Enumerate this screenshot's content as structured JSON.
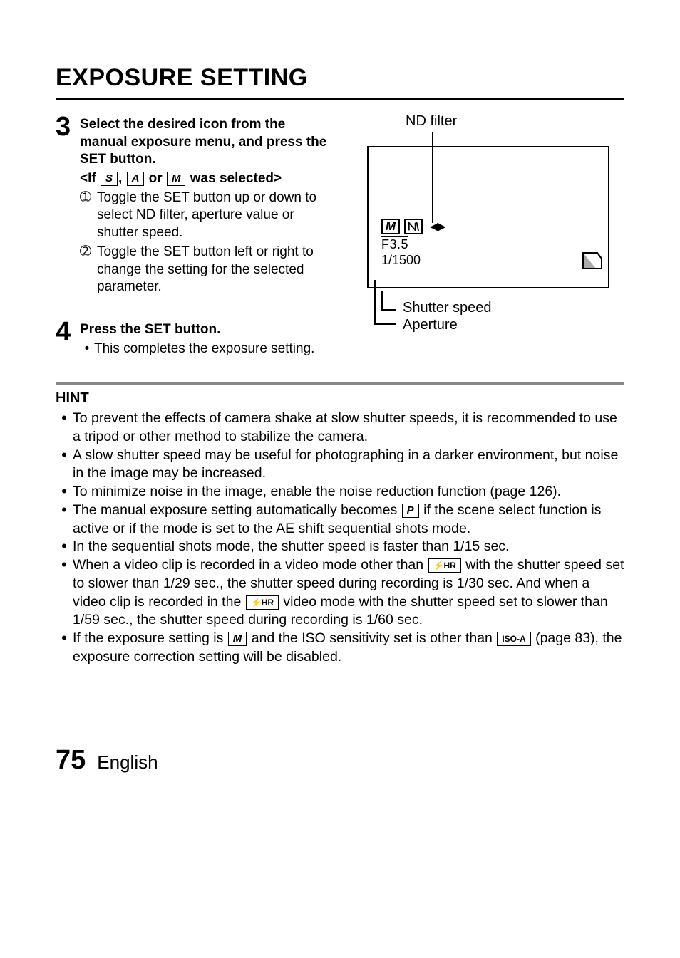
{
  "title": "EXPOSURE SETTING",
  "step3": {
    "num": "3",
    "head": "Select the desired icon from the manual exposure menu, and press the SET button.",
    "subhead_prefix": "<If ",
    "modeS": "S",
    "subhead_sep1": ", ",
    "modeA": "A",
    "subhead_sep2": " or ",
    "modeM": "M",
    "subhead_suffix": " was selected>",
    "item1_num": "➀",
    "item1_text": "Toggle the SET button up or down to select ND filter, aperture value or shutter speed.",
    "item2_num": "➁",
    "item2_text": "Toggle the SET button left or right to change the setting for the selected parameter."
  },
  "step4": {
    "num": "4",
    "head": "Press the SET button.",
    "bullet": "•",
    "text": "This completes the exposure setting."
  },
  "diagram": {
    "nd_label": "ND filter",
    "shutter_label": "Shutter speed",
    "aperture_label": "Aperture",
    "osd_m": "M",
    "osd_f": "F3.5",
    "osd_shutter": "1/1500",
    "osd_arrows": "◀▶"
  },
  "hint": {
    "title": "HINT",
    "bullet": "•",
    "items": {
      "a": "To prevent the effects of camera shake at slow shutter speeds, it is recommended to use a tripod or other method to stabilize the camera.",
      "b": "A slow shutter speed may be useful for photographing in a darker environment, but noise in the image may be increased.",
      "c": "To minimize noise in the image, enable the noise reduction function (page 126).",
      "d_pre": "The manual exposure setting automatically becomes ",
      "d_modeP": "P",
      "d_post": " if the scene select function is active or if the mode is set to the AE shift sequential shots mode.",
      "e": "In the sequential shots mode, the shutter speed is faster than 1/15 sec.",
      "f_pre": "When a video clip is recorded in a video mode other than ",
      "f_hr1": "⚡HR",
      "f_mid": " with the shutter speed set to slower than 1/29 sec., the shutter speed during recording is 1/30 sec. And when a video clip is recorded in the ",
      "f_hr2": "⚡HR",
      "f_post": " video mode with the shutter speed set to slower than 1/59 sec., the shutter speed during recording is 1/60 sec.",
      "g_pre": "If the exposure setting is ",
      "g_modeM": "M",
      "g_mid": " and the ISO sensitivity set is other than ",
      "g_iso": "ISO-A",
      "g_post": " (page 83), the exposure correction setting will be disabled."
    }
  },
  "footer": {
    "page": "75",
    "lang": "English"
  }
}
